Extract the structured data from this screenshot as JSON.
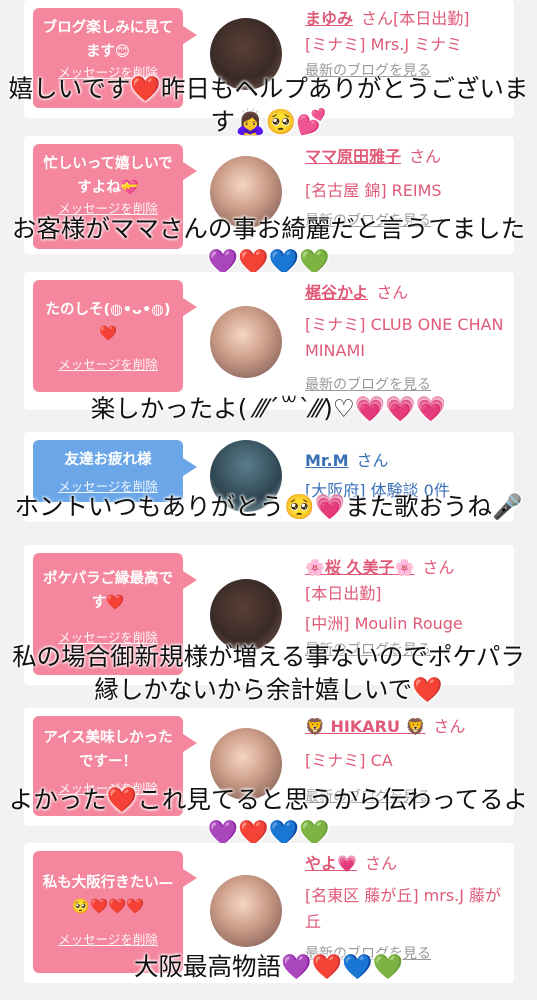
{
  "entries": [
    {
      "message": "ブログ楽しみに見てます😊",
      "delete_label": "メッセージを削除",
      "name": "まゆみ",
      "honorific": "さん",
      "status": "[本日出勤]",
      "shop": "[ミナミ] Mrs.J ミナミ",
      "latest_link": "最新のブログを見る",
      "caption": "嬉しいです❤️昨日もヘルプありがとうございます🙇‍♀️🥺💕"
    },
    {
      "message": "忙しいって嬉しいですよね💝",
      "delete_label": "メッセージを削除",
      "name": "ママ原田雅子",
      "honorific": "さん",
      "shop": "[名古屋 錦] REIMS",
      "latest_link": "最新のブログを見る",
      "caption": "お客様がママさんの事お綺麗だと言うてました💜❤️💙💚"
    },
    {
      "message": "たのしそ(◍•ᴗ•◍)❤️",
      "delete_label": "メッセージを削除",
      "name": "梶谷かよ",
      "honorific": "さん",
      "shop": "[ミナミ] CLUB ONE CHAN MINAMI",
      "latest_link": "最新のブログを見る",
      "caption": "楽しかったよ( ⁄⁄⁄ˊ꒳ˋ⁄⁄⁄)♡💗💗💗"
    },
    {
      "message": "友達お疲れ様",
      "delete_label": "メッセージを削除",
      "name": "Mr.M",
      "honorific": "さん",
      "shop": "[大阪府] 体験談 0件",
      "caption": "ホントいつもありがとう🥺💗また歌おうね🎤"
    },
    {
      "message": "ポケパラご縁最高です❤️",
      "delete_label": "メッセージを削除",
      "name": "🌸桜 久美子🌸",
      "honorific": "さん",
      "status": "[本日出勤]",
      "shop": "[中洲] Moulin Rouge",
      "latest_link": "最新のブログを見る",
      "caption": "私の場合御新規様が増える事ないのでポケパラ縁しかないから余計嬉しいで❤️"
    },
    {
      "message": "アイス美味しかったですー！",
      "delete_label": "メッセージを削除",
      "name": "🦁 HIKARU 🦁",
      "honorific": "さん",
      "shop": "[ミナミ] CA",
      "latest_link": "最新のブログを見る",
      "caption": "よかった❤️これ見てると思うから伝わってるよ💜❤️💙💚"
    },
    {
      "message": "私も大阪行きたい—🥺❤️❤️❤️",
      "delete_label": "メッセージを削除",
      "name": "やよ💗",
      "honorific": "さん",
      "shop": "[名東区 藤が丘] mrs.J 藤が丘",
      "latest_link": "最新のブログを見る",
      "caption": "大阪最高物語💜❤️💙💚"
    }
  ],
  "colors": {
    "bubble_pink": "#f4879d",
    "bubble_blue": "#6ba7e8",
    "name_pink": "#e05a78",
    "name_blue": "#3a70b8",
    "background": "#f2f2f3"
  }
}
